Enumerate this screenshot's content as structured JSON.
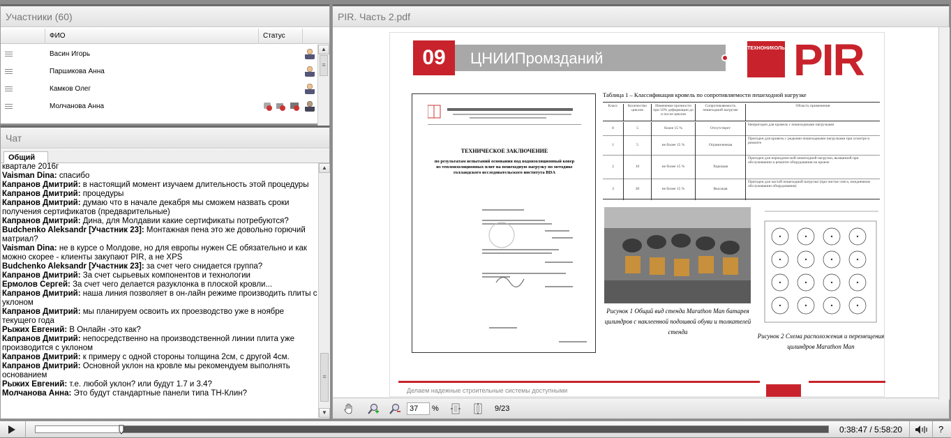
{
  "participants": {
    "title": "Участники (60)",
    "columns": {
      "name": "ФИО",
      "status": "Статус"
    },
    "rows": [
      {
        "name": "Васин Игорь"
      },
      {
        "name": "Паршикова Анна"
      },
      {
        "name": "Камков Олег"
      },
      {
        "name": "Молчанова Анна"
      }
    ]
  },
  "chat": {
    "title": "Чат",
    "tab": "Общий",
    "messages": [
      {
        "author": "",
        "text": "квартале 2016г"
      },
      {
        "author": "Vaisman Dina:",
        "text": " спасибо"
      },
      {
        "author": "Капранов Дмитрий:",
        "text": " в настоящий момент изучаем длительность этой процедуры"
      },
      {
        "author": "Капранов Дмитрий:",
        "text": " процедуры"
      },
      {
        "author": "Капранов Дмитрий:",
        "text": " думаю что в начале декабря мы сможем назвать сроки получения сертификатов (предварительные)"
      },
      {
        "author": "Капранов Дмитрий:",
        "text": " Дина, для Молдавии какие сертификаты потребуются?"
      },
      {
        "author": "Budchenko Aleksandr [Участник 23]:",
        "text": " Монтажная пена это же довольно горючий матриал?"
      },
      {
        "author": "Vaisman Dina:",
        "text": " не в курсе о Молдове, но для европы нужен CE обязательно и как можно скорее - клиенты закупают PIR, а не XPS"
      },
      {
        "author": "Budchenko Aleksandr [Участник 23]:",
        "text": " за счет чего снидается группа?"
      },
      {
        "author": "Капранов Дмитрий:",
        "text": " За счет сырьевых компонентов и технологии"
      },
      {
        "author": "Ермолов Сергей:",
        "text": " За счет чего делается разуклонка в плоской кровли..."
      },
      {
        "author": "Капранов Дмитрий:",
        "text": " наша линия позволяет в он-лайн режиме производить плиты с уклоном"
      },
      {
        "author": "Капранов Дмитрий:",
        "text": " мы планируем освоить их проезводство уже в ноябре текущего года"
      },
      {
        "author": "Рыжих Евгений:",
        "text": " В Онлайн -это как?"
      },
      {
        "author": "Капранов Дмитрий:",
        "text": " непосредственно на производственной линии плита уже производится с уклоном"
      },
      {
        "author": "Капранов Дмитрий:",
        "text": " к примеру с одной стороны толщина 2см, с другой 4см."
      },
      {
        "author": "Капранов Дмитрий:",
        "text": " Основной уклон на кровле мы рекомендуем выполнять основанием"
      },
      {
        "author": "Рыжих Евгений:",
        "text": " т.е. любой уклон? или будут 1.7 и 3.4?"
      },
      {
        "author": "Молчанова Анна:",
        "text": " Это будут стандартные панели типа ТН-Клин?"
      }
    ]
  },
  "pdf": {
    "title": "PIR. Часть 2.pdf",
    "slide": {
      "number": "09",
      "org": "ЦНИИПромзданий",
      "brand": "PIR",
      "brand_logo": "ТЕХНОНИКОЛЬ",
      "doc_title": "ТЕХНИЧЕСКОЕ ЗАКЛЮЧЕНИЕ",
      "doc_subtitle": "по результатам испытаний основания под водоизоляционный ковер из теплоизоляционных плит на пешеходную нагрузку по методике голландского исследовательского института BDA",
      "table_title": "Таблица 1 – Классификация кровель по сопротивляемости пешеходной нагрузке",
      "table_headers": [
        "Класс",
        "Количество циклов",
        "Изменение прочности при 10% деформации до и после циклов",
        "Сопротивляемость пешеходной нагрузке",
        "Область применения"
      ],
      "table_rows": [
        [
          "0",
          "5",
          "более 15 %",
          "Отсутствует",
          "Непригоден для кровель с пешеходными нагрузками"
        ],
        [
          "1",
          "5",
          "не более 15 %",
          "Ограниченная",
          "Пригоден для кровель с редкими пешеходными нагрузками при осмотре и ремонте"
        ],
        [
          "2",
          "10",
          "не более 15 %",
          "Хорошая",
          "Пригоден для периодической пешеходной нагрузки, вызванной при обслуживании и ремонте оборудования на кровле"
        ],
        [
          "3",
          "30",
          "не более 15 %",
          "Высокая",
          "Пригоден для частой пешеходной нагрузки (при чистке снега, ежедневном обслуживании оборудования)"
        ]
      ],
      "caption1": "Рисунок 1 Общий вид стенда Marathon Man батарея цилиндров с наклеенной подошвой обуви и толкателей стенда",
      "caption2": "Рисунок 2 Схема расположения и перемещения цилиндров Marathon Man",
      "footer": "Делаем надежные строительные системы доступными"
    },
    "zoom": "37",
    "zoom_unit": "%",
    "page_indicator": "9/23"
  },
  "player": {
    "time": "0:38:47 / 5:58:20",
    "progress": 0.108,
    "help": "?"
  }
}
